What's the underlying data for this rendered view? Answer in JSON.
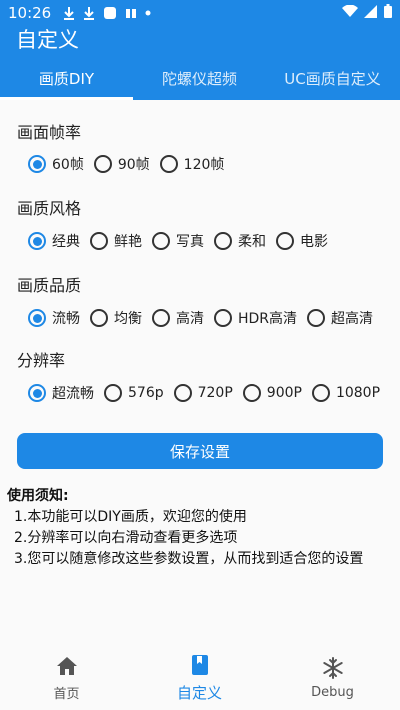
{
  "status_bar": {
    "time": "10:26"
  },
  "app_bar": {
    "title": "自定义"
  },
  "tabs": [
    {
      "label": "画质DIY",
      "active": true
    },
    {
      "label": "陀螺仪超频",
      "active": false
    },
    {
      "label": "UC画质自定义",
      "active": false
    }
  ],
  "sections": [
    {
      "label": "画面帧率",
      "options": [
        {
          "label": "60帧",
          "checked": true
        },
        {
          "label": "90帧",
          "checked": false
        },
        {
          "label": "120帧",
          "checked": false
        }
      ]
    },
    {
      "label": "画质风格",
      "options": [
        {
          "label": "经典",
          "checked": true
        },
        {
          "label": "鲜艳",
          "checked": false
        },
        {
          "label": "写真",
          "checked": false
        },
        {
          "label": "柔和",
          "checked": false
        },
        {
          "label": "电影",
          "checked": false
        }
      ]
    },
    {
      "label": "画质品质",
      "options": [
        {
          "label": "流畅",
          "checked": true
        },
        {
          "label": "均衡",
          "checked": false
        },
        {
          "label": "高清",
          "checked": false
        },
        {
          "label": "HDR高清",
          "checked": false
        },
        {
          "label": "超高清",
          "checked": false
        }
      ]
    },
    {
      "label": "分辨率",
      "options": [
        {
          "label": "超流畅",
          "checked": true
        },
        {
          "label": "576p",
          "checked": false
        },
        {
          "label": "720P",
          "checked": false
        },
        {
          "label": "900P",
          "checked": false
        },
        {
          "label": "1080P",
          "checked": false
        }
      ]
    }
  ],
  "save_button": {
    "label": "保存设置"
  },
  "notes": {
    "title": "使用须知:",
    "items": [
      "1.本功能可以DIY画质，欢迎您的使用",
      "2.分辨率可以向右滑动查看更多选项",
      "3.您可以随意修改这些参数设置，从而找到适合您的设置"
    ]
  },
  "bottom_nav": [
    {
      "label": "首页",
      "icon": "home-icon",
      "active": false
    },
    {
      "label": "自定义",
      "icon": "book-icon",
      "active": true
    },
    {
      "label": "Debug",
      "icon": "snowflake-icon",
      "active": false
    }
  ],
  "colors": {
    "primary": "#1e88e5",
    "background": "#fafafa"
  }
}
